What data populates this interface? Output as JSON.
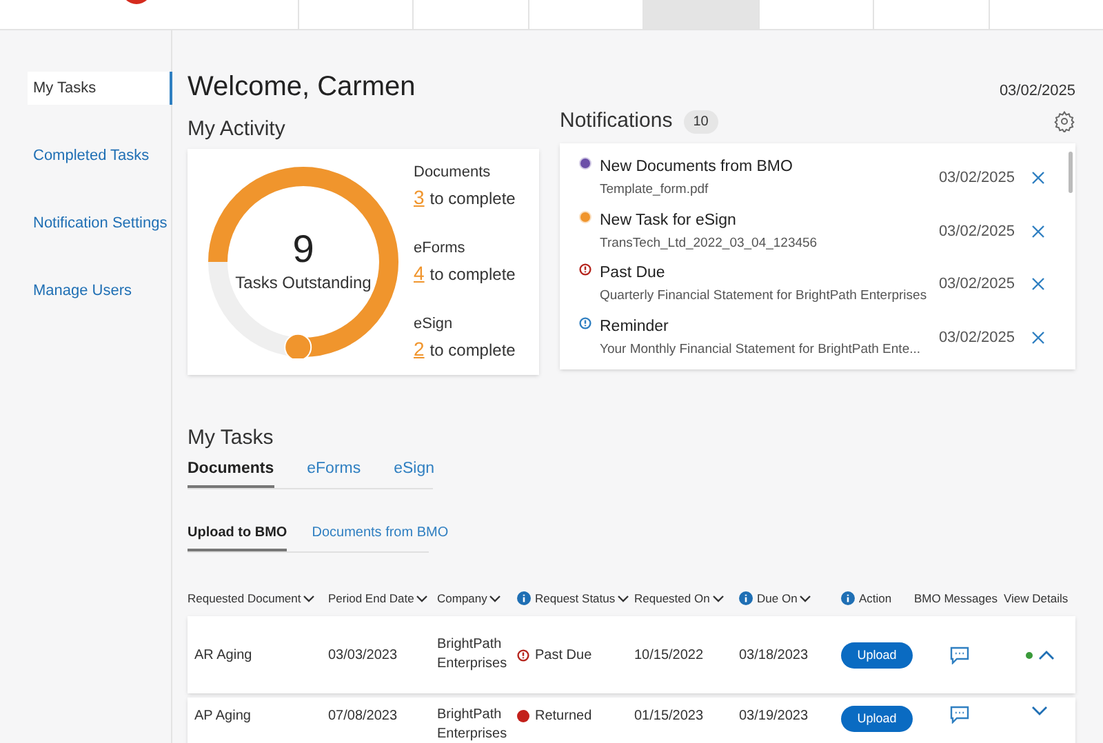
{
  "top_nav": [
    {
      "selected": false
    },
    {
      "selected": false
    },
    {
      "selected": false
    },
    {
      "selected": true
    },
    {
      "selected": false
    },
    {
      "selected": false
    },
    {
      "selected": false
    }
  ],
  "sidebar": {
    "items": [
      {
        "label": "My Tasks",
        "selected": true
      },
      {
        "label": "Completed Tasks",
        "selected": false
      },
      {
        "label": "Notification Settings",
        "selected": false
      },
      {
        "label": "Manage Users",
        "selected": false
      }
    ]
  },
  "welcome": "Welcome, Carmen",
  "date": "03/02/2025",
  "activity": {
    "title": "My Activity",
    "total": "9",
    "total_label": "Tasks Outstanding",
    "level": 0.76,
    "items": [
      {
        "name": "Documents",
        "count": "3",
        "suffix": "to complete"
      },
      {
        "name": "eForms",
        "count": "4",
        "suffix": "to complete"
      },
      {
        "name": "eSign",
        "count": "2",
        "suffix": "to complete"
      }
    ]
  },
  "notifications": {
    "title": "Notifications",
    "count": "10",
    "items": [
      {
        "title": "New Documents from BMO",
        "detail": "Template_form.pdf",
        "date": "03/02/2025",
        "color": "#6b4fa8",
        "kind": "dot"
      },
      {
        "title": "New Task for eSign",
        "detail": "TransTech_Ltd_2022_03_04_123456",
        "date": "03/02/2025",
        "color": "#f0952d",
        "kind": "dot"
      },
      {
        "title": "Past Due",
        "detail": "Quarterly Financial Statement for BrightPath Enterprises",
        "date": "03/02/2025",
        "color": "#b5251d",
        "kind": "alert"
      },
      {
        "title": "Reminder",
        "detail": "Your Monthly Financial Statement for BrightPath Ente...",
        "date": "03/02/2025",
        "color": "#2f7fc1",
        "kind": "alert"
      }
    ]
  },
  "tasks": {
    "title": "My Tasks",
    "tabs": [
      {
        "label": "Documents",
        "selected": true
      },
      {
        "label": "eForms",
        "selected": false
      },
      {
        "label": "eSign",
        "selected": false
      }
    ],
    "subtabs": [
      {
        "label": "Upload to BMO",
        "selected": true
      },
      {
        "label": "Documents from BMO",
        "selected": false
      }
    ],
    "columns": [
      {
        "label": "Requested Document",
        "info": false,
        "sort": true
      },
      {
        "label": "Period End Date",
        "info": false,
        "sort": true
      },
      {
        "label": "Company",
        "info": false,
        "sort": true
      },
      {
        "label": "Request Status",
        "info": true,
        "sort": true
      },
      {
        "label": "Requested On",
        "info": false,
        "sort": true
      },
      {
        "label": "Due On",
        "info": true,
        "sort": true
      },
      {
        "label": "Action",
        "info": true,
        "sort": false
      },
      {
        "label": "BMO Messages",
        "info": false,
        "sort": false
      },
      {
        "label": "View Details",
        "info": false,
        "sort": false
      }
    ],
    "rows": [
      {
        "document": "AR Aging",
        "period_end": "03/03/2023",
        "company": "BrightPath Enterprises",
        "status": {
          "text": "Past Due",
          "kind": "alert"
        },
        "requested_on": "10/15/2022",
        "due_on": "03/18/2023",
        "action": "Upload",
        "expanded": true,
        "new": true
      },
      {
        "document": "AP Aging",
        "period_end": "07/08/2023",
        "company": "BrightPath Enterprises",
        "status": {
          "text": "Returned",
          "kind": "dot"
        },
        "requested_on": "01/15/2023",
        "due_on": "03/19/2023",
        "action": "Upload",
        "expanded": false,
        "new": false
      }
    ]
  }
}
